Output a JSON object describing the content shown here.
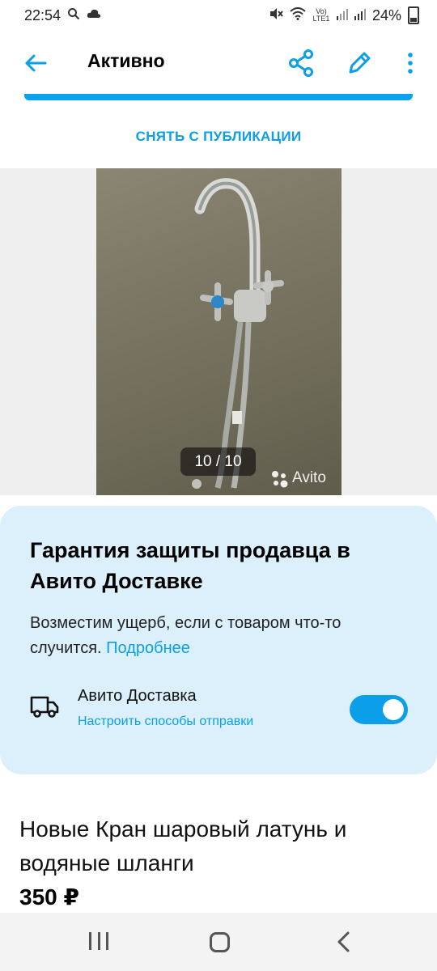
{
  "status_bar": {
    "time": "22:54",
    "network_label": "Vo) LTE1",
    "battery": "24%"
  },
  "app_bar": {
    "title": "Активно",
    "icons": [
      "back-arrow-icon",
      "share-icon",
      "edit-icon",
      "more-vert-icon"
    ]
  },
  "actions": {
    "unpublish": "СНЯТЬ С ПУБЛИКАЦИИ"
  },
  "gallery": {
    "counter": "10 / 10",
    "watermark": "Avito"
  },
  "guarantee": {
    "title": "Гарантия защиты продавца в Авито Доставке",
    "text": "Возместим ущерб, если с товаром что-то случится.",
    "link": "Подробнее",
    "delivery_title": "Авито Доставка",
    "delivery_sub": "Настроить способы отправки",
    "toggle_on": true
  },
  "product": {
    "title": "Новые Кран шаровый латунь и водяные шланги",
    "price": "350 ₽"
  },
  "colors": {
    "accent": "#0a9fe8",
    "card_bg": "#dcf0fc"
  }
}
